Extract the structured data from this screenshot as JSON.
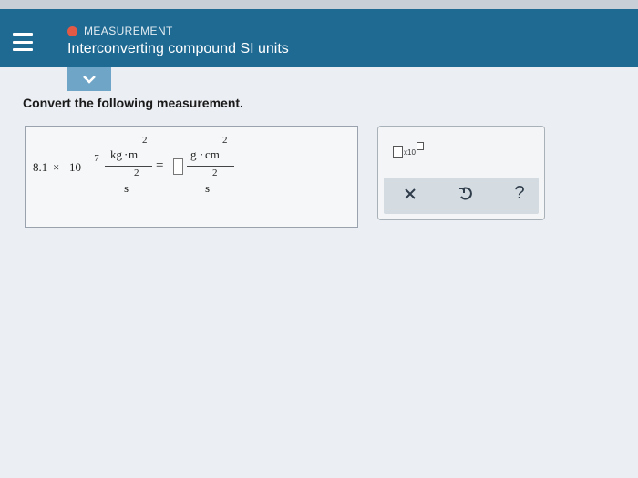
{
  "header": {
    "category": "MEASUREMENT",
    "title": "Interconverting compound SI units",
    "status_color": "#e25a46",
    "bar_color": "#1f6a93"
  },
  "problem": {
    "instruction": "Convert the following measurement.",
    "given": {
      "coefficient": "8.1",
      "times": "×",
      "base": "10",
      "exponent": "−7",
      "num_unit_1": "kg",
      "dot": "·",
      "num_unit_2": "m",
      "num_exp": "2",
      "den_unit": "s",
      "den_exp": "2"
    },
    "equals": "=",
    "target": {
      "num_unit_1": "g",
      "dot": "·",
      "num_unit_2": "cm",
      "num_exp": "2",
      "den_unit": "s",
      "den_exp": "2"
    },
    "answer_value": ""
  },
  "tools": {
    "x10_label": "x10",
    "clear_icon": "close-icon",
    "undo_icon": "undo-icon",
    "help_label": "?"
  }
}
